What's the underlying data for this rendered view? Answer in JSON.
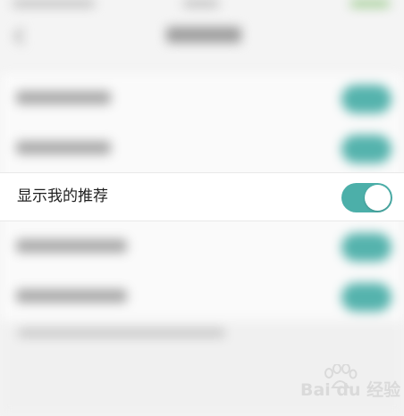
{
  "settings": {
    "focused_item": {
      "label": "显示我的推荐",
      "toggle_on": true
    }
  },
  "colors": {
    "toggle_on": "#4cafa9",
    "background": "#f4f4f4",
    "row_background": "#ffffff"
  },
  "watermark": {
    "text": "Bai du 经验"
  },
  "icons": [
    "back-arrow-icon",
    "baidu-paw-logo-icon"
  ]
}
